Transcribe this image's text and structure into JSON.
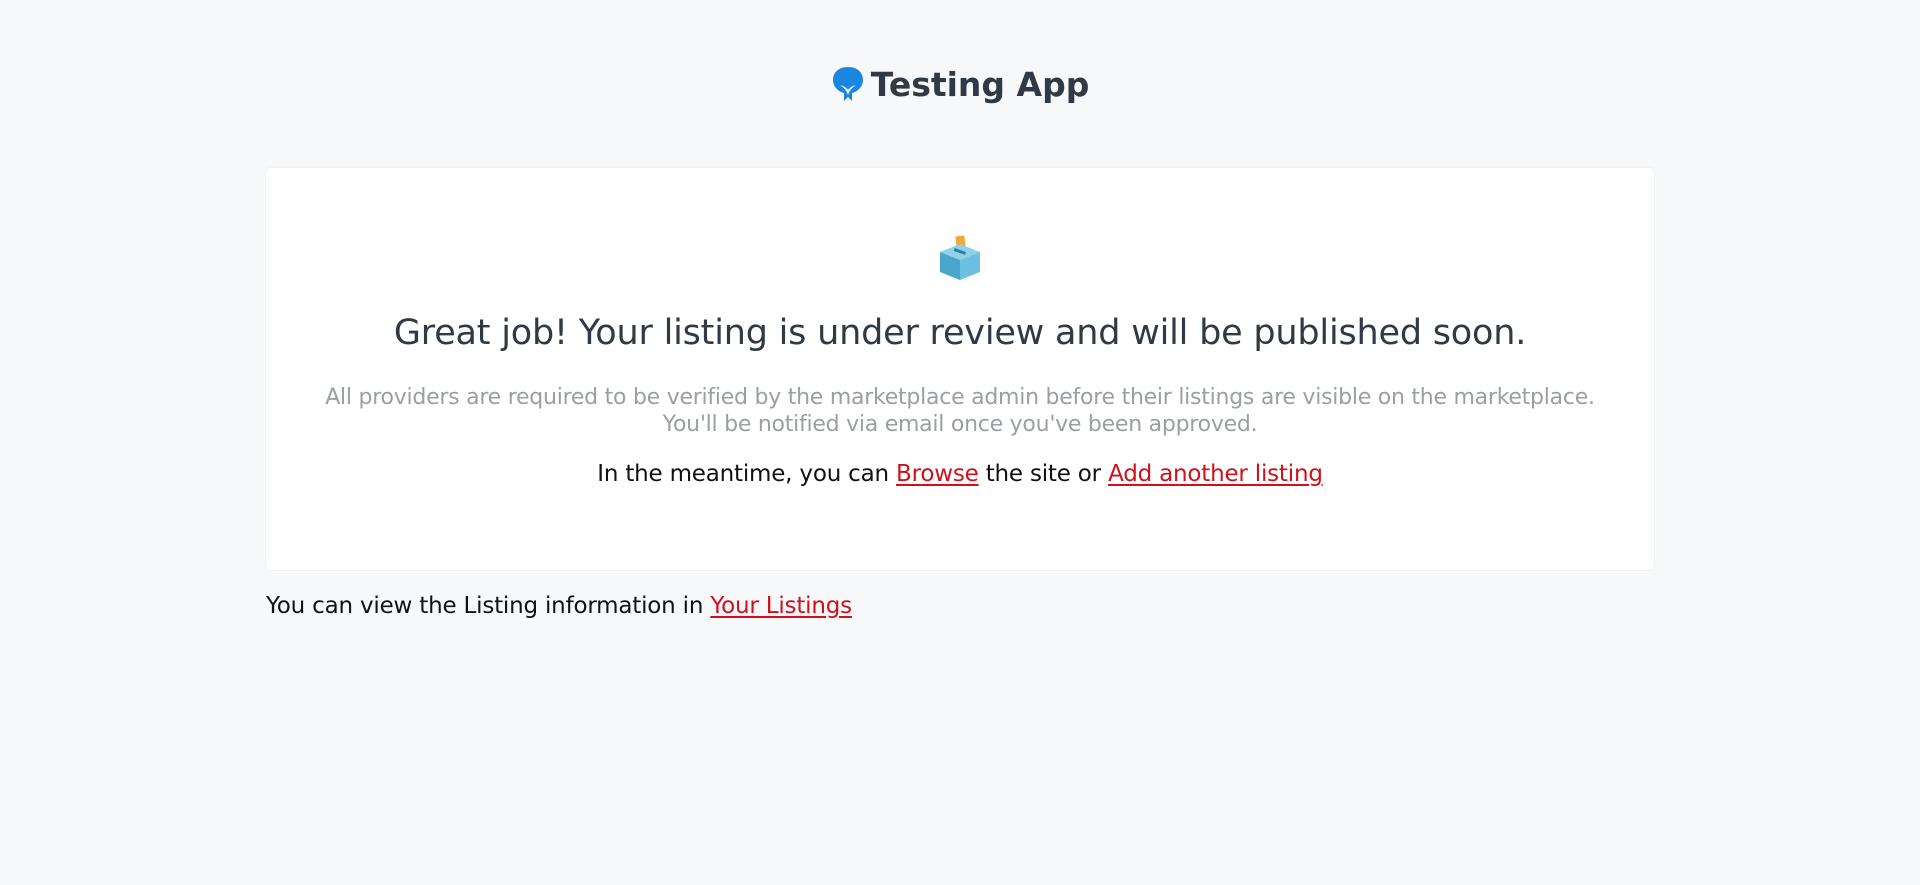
{
  "header": {
    "brand_name": "Testing App",
    "logo_icon": "shield-sprout-logo",
    "brand_color": "#1a86e0"
  },
  "card": {
    "icon": "ballot-box-icon",
    "headline": "Great job! Your listing is under review and will be published soon.",
    "note_line1": "All providers are required to be verified by the marketplace admin before their listings are visible on the marketplace.",
    "note_line2": "You'll be notified via email once you've been approved.",
    "meantime_prefix": "In the meantime, you can",
    "browse_link": "Browse",
    "meantime_middle": "the site or",
    "add_listing_link": "Add another listing"
  },
  "footer": {
    "text": "You can view the Listing information in",
    "your_listings_link": "Your Listings"
  },
  "colors": {
    "link": "#d0111b",
    "heading": "#2f3a44",
    "muted": "#9a9fa6",
    "background": "#f7f8fa"
  }
}
